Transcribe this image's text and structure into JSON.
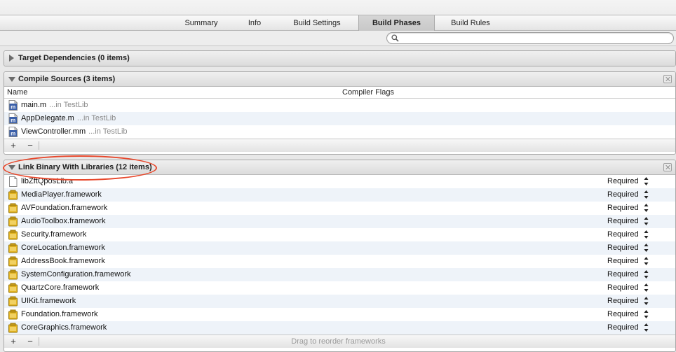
{
  "tabs": [
    {
      "label": "Summary",
      "active": false
    },
    {
      "label": "Info",
      "active": false
    },
    {
      "label": "Build Settings",
      "active": false
    },
    {
      "label": "Build Phases",
      "active": true
    },
    {
      "label": "Build Rules",
      "active": false
    }
  ],
  "search": {
    "placeholder": "",
    "value": ""
  },
  "target_dependencies": {
    "title": "Target Dependencies (0 items)"
  },
  "compile_sources": {
    "title": "Compile Sources (3 items)",
    "col_name": "Name",
    "col_flags": "Compiler Flags",
    "files": [
      {
        "name": "main.m",
        "path": "...in TestLib"
      },
      {
        "name": "AppDelegate.m",
        "path": "...in TestLib"
      },
      {
        "name": "ViewController.mm",
        "path": "...in TestLib"
      }
    ],
    "add_label": "+",
    "remove_label": "−"
  },
  "link_binary": {
    "title": "Link Binary With Libraries (12 items)",
    "items": [
      {
        "name": "libZftQposLib.a",
        "status": "Required",
        "icon": "file-icon"
      },
      {
        "name": "MediaPlayer.framework",
        "status": "Required",
        "icon": "framework-icon"
      },
      {
        "name": "AVFoundation.framework",
        "status": "Required",
        "icon": "framework-icon"
      },
      {
        "name": "AudioToolbox.framework",
        "status": "Required",
        "icon": "framework-icon"
      },
      {
        "name": "Security.framework",
        "status": "Required",
        "icon": "framework-icon"
      },
      {
        "name": "CoreLocation.framework",
        "status": "Required",
        "icon": "framework-icon"
      },
      {
        "name": "AddressBook.framework",
        "status": "Required",
        "icon": "framework-icon"
      },
      {
        "name": "SystemConfiguration.framework",
        "status": "Required",
        "icon": "framework-icon"
      },
      {
        "name": "QuartzCore.framework",
        "status": "Required",
        "icon": "framework-icon"
      },
      {
        "name": "UIKit.framework",
        "status": "Required",
        "icon": "framework-icon"
      },
      {
        "name": "Foundation.framework",
        "status": "Required",
        "icon": "framework-icon"
      },
      {
        "name": "CoreGraphics.framework",
        "status": "Required",
        "icon": "framework-icon"
      }
    ],
    "add_label": "+",
    "remove_label": "−",
    "footer_hint": "Drag to reorder frameworks"
  },
  "colors": {
    "highlight_ring": "#e8482c",
    "alt_row": "#eef3f9",
    "framework_icon": "#e2b320"
  }
}
